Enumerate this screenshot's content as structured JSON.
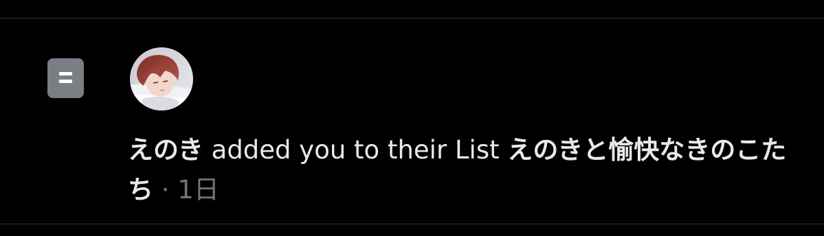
{
  "notification": {
    "icon": "list-icon",
    "accent_color": "#7b7e84",
    "avatar_alt": "avatar",
    "user_name": "えのき",
    "action_text": " added you to their List ",
    "list_name": "えのきと愉快なきのこたち",
    "separator": " · ",
    "time": "1日"
  }
}
